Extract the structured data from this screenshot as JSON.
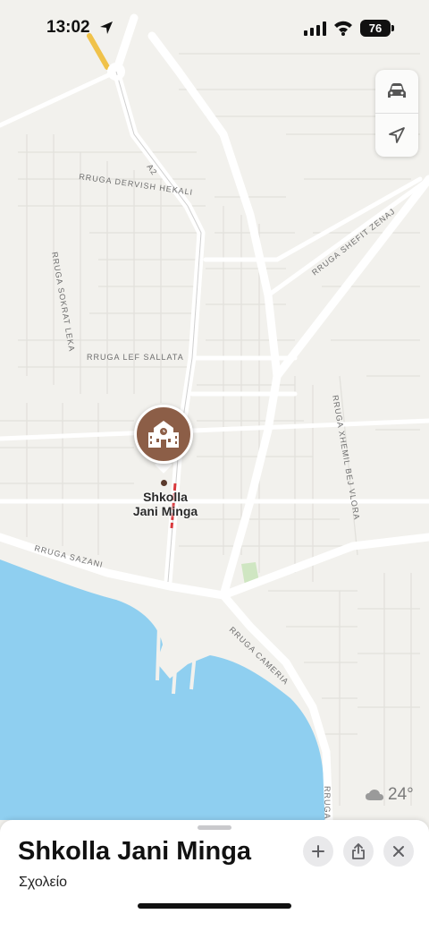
{
  "status_bar": {
    "time": "13:02",
    "battery": "76"
  },
  "map": {
    "road_labels": [
      "A2",
      "RRUGA DERVISH HEKALI",
      "RRUGA SHEFIT ZENAJ",
      "RRUGA SOKRAT LEKA",
      "RRUGA LEF SALLATA",
      "RRUGA XHEMIL BEJ VLORA",
      "RRUGA SAZANI",
      "RRUGA CAMERIA",
      "RRUGA"
    ],
    "place_label_line1": "Shkolla",
    "place_label_line2": "Jani Minga",
    "controls": {
      "drive_icon": "car-icon",
      "locate_icon": "location-arrow-icon"
    },
    "weather": {
      "temperature": "24°",
      "icon": "cloud-icon"
    },
    "colors": {
      "land": "#f2f1ed",
      "water": "#8fcff0",
      "road": "#ffffff",
      "pin": "#8c5e47"
    }
  },
  "sheet": {
    "title": "Shkolla Jani Minga",
    "subtitle": "Σχολείο",
    "actions": [
      "plus-icon",
      "share-icon",
      "close-icon"
    ]
  }
}
